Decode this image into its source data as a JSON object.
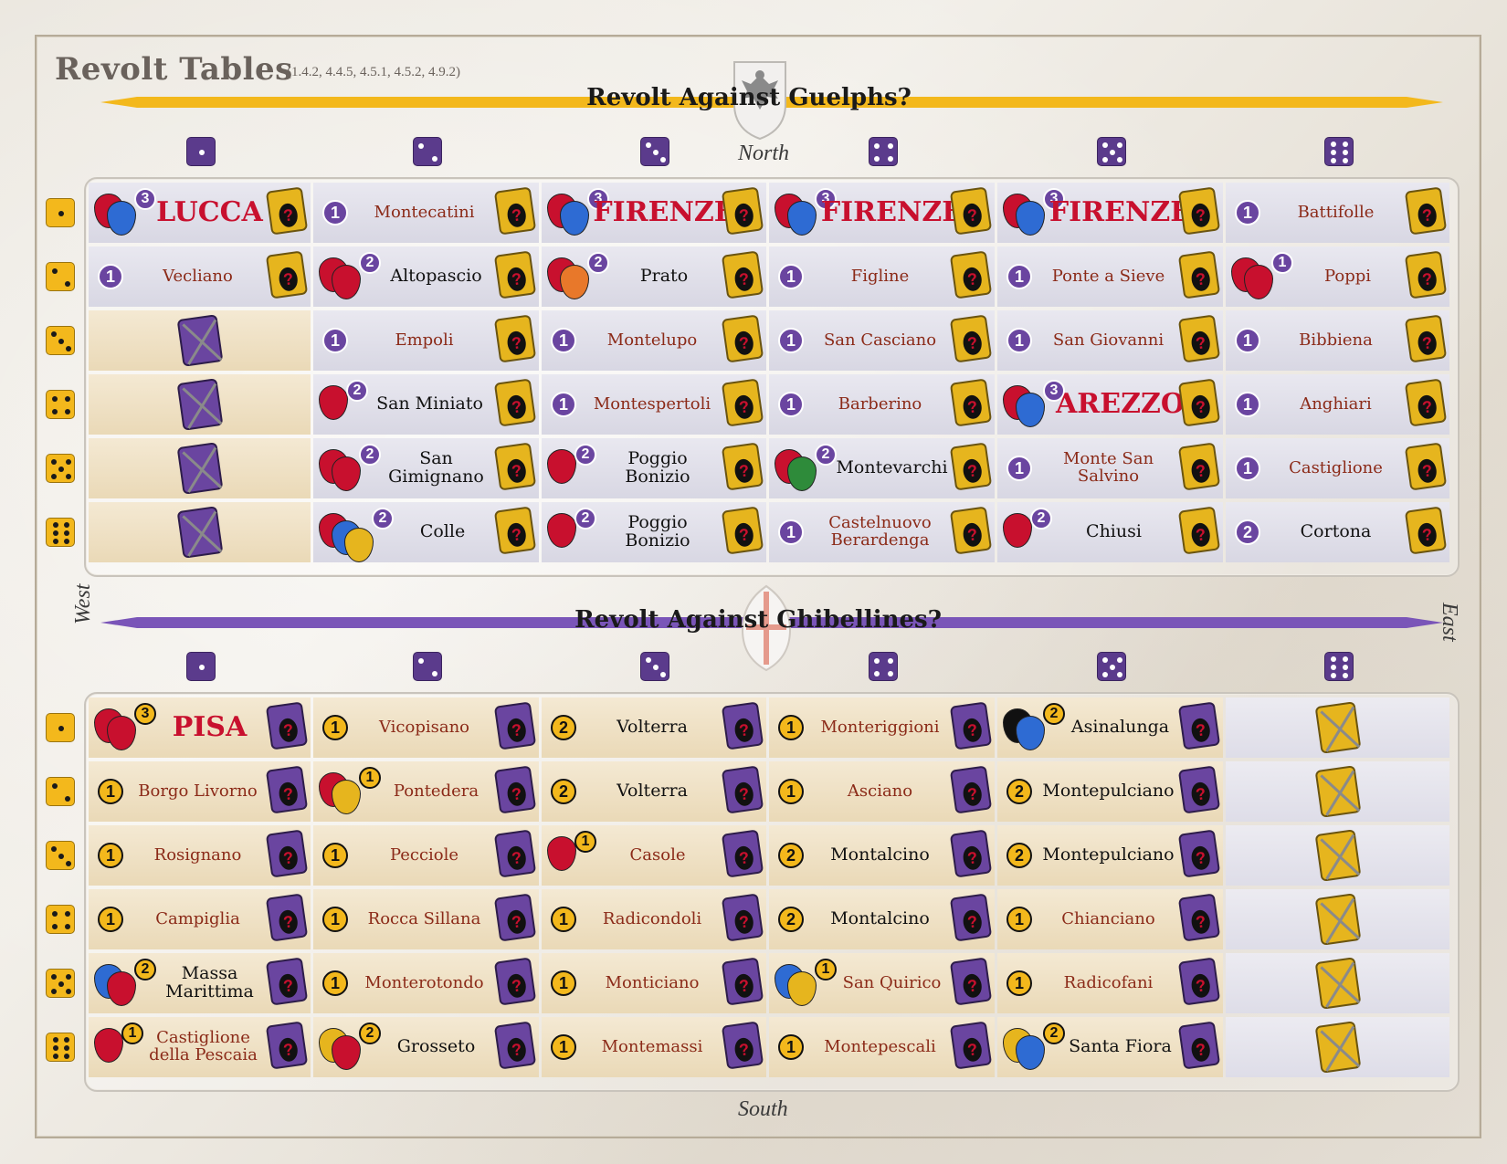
{
  "title": "Revolt Tables",
  "title_refs": "(1.4.2, 4.4.5, 4.5.1, 4.5.2, 4.9.2)",
  "compass": {
    "north": "North",
    "south": "South",
    "west": "West",
    "east": "East"
  },
  "colors": {
    "guelph_purple": "#6a45a0",
    "ghibelline_yellow": "#f3b81c",
    "city_red": "#c8102e",
    "town_brown": "#8b2a18"
  },
  "guelph_table": {
    "banner": "Revolt Against Guelphs?",
    "column_dice": [
      1,
      2,
      3,
      4,
      5,
      6
    ],
    "row_dice": [
      1,
      2,
      3,
      4,
      5,
      6
    ],
    "rows": [
      [
        {
          "name": "LUCCA",
          "style": "big",
          "value": "3",
          "shields": [
            "#c8102e",
            "#2e6bd3"
          ],
          "token": "ghibelline"
        },
        {
          "name": "Montecatini",
          "style": "red",
          "value": "1",
          "token": "ghibelline"
        },
        {
          "name": "FIRENZE",
          "style": "big",
          "value": "3",
          "shields": [
            "#c8102e",
            "#2e6bd3"
          ],
          "token": "ghibelline"
        },
        {
          "name": "FIRENZE",
          "style": "big",
          "value": "3",
          "shields": [
            "#c8102e",
            "#2e6bd3"
          ],
          "token": "ghibelline"
        },
        {
          "name": "FIRENZE",
          "style": "big",
          "value": "3",
          "shields": [
            "#c8102e",
            "#2e6bd3"
          ],
          "token": "ghibelline"
        },
        {
          "name": "Battifolle",
          "style": "red",
          "value": "1",
          "token": "ghibelline"
        }
      ],
      [
        {
          "name": "Vecliano",
          "style": "red",
          "value": "1",
          "token": "ghibelline"
        },
        {
          "name": "Altopascio",
          "style": "blk",
          "value": "2",
          "shields": [
            "#c8102e",
            "#c8102e"
          ],
          "token": "ghibelline"
        },
        {
          "name": "Prato",
          "style": "blk",
          "value": "2",
          "shields": [
            "#c8102e",
            "#e8782a"
          ],
          "token": "ghibelline"
        },
        {
          "name": "Figline",
          "style": "red",
          "value": "1",
          "token": "ghibelline"
        },
        {
          "name": "Ponte a Sieve",
          "style": "red",
          "value": "1",
          "token": "ghibelline"
        },
        {
          "name": "Poppi",
          "style": "red",
          "value": "1",
          "shields": [
            "#c8102e",
            "#c8102e"
          ],
          "token": "ghibelline"
        }
      ],
      [
        {
          "name": "",
          "style": "none",
          "value": "",
          "token": "guelph-x"
        },
        {
          "name": "Empoli",
          "style": "red",
          "value": "1",
          "token": "ghibelline"
        },
        {
          "name": "Montelupo",
          "style": "red",
          "value": "1",
          "token": "ghibelline"
        },
        {
          "name": "San Casciano",
          "style": "red",
          "value": "1",
          "token": "ghibelline"
        },
        {
          "name": "San Giovanni",
          "style": "red",
          "value": "1",
          "token": "ghibelline"
        },
        {
          "name": "Bibbiena",
          "style": "red",
          "value": "1",
          "token": "ghibelline"
        }
      ],
      [
        {
          "name": "",
          "style": "none",
          "value": "",
          "token": "guelph-x"
        },
        {
          "name": "San Miniato",
          "style": "blk",
          "value": "2",
          "shields": [
            "#c8102e"
          ],
          "token": "ghibelline"
        },
        {
          "name": "Montespertoli",
          "style": "red",
          "value": "1",
          "token": "ghibelline"
        },
        {
          "name": "Barberino",
          "style": "red",
          "value": "1",
          "token": "ghibelline"
        },
        {
          "name": "AREZZO",
          "style": "big",
          "value": "3",
          "shields": [
            "#c8102e",
            "#2e6bd3"
          ],
          "token": "ghibelline"
        },
        {
          "name": "Anghiari",
          "style": "red",
          "value": "1",
          "token": "ghibelline"
        }
      ],
      [
        {
          "name": "",
          "style": "none",
          "value": "",
          "token": "guelph-x"
        },
        {
          "name": "San Gimignano",
          "style": "blk",
          "value": "2",
          "shields": [
            "#c8102e",
            "#c8102e"
          ],
          "token": "ghibelline"
        },
        {
          "name": "Poggio Bonizio",
          "style": "blk",
          "value": "2",
          "shields": [
            "#c8102e"
          ],
          "token": "ghibelline"
        },
        {
          "name": "Montevarchi",
          "style": "blk",
          "value": "2",
          "shields": [
            "#c8102e",
            "#2e8b3a"
          ],
          "token": "ghibelline"
        },
        {
          "name": "Monte San Salvino",
          "style": "red",
          "value": "1",
          "token": "ghibelline"
        },
        {
          "name": "Castiglione",
          "style": "red",
          "value": "1",
          "token": "ghibelline"
        }
      ],
      [
        {
          "name": "",
          "style": "none",
          "value": "",
          "token": "guelph-x"
        },
        {
          "name": "Colle",
          "style": "blk",
          "value": "2",
          "shields": [
            "#c8102e",
            "#2e6bd3",
            "#e6b51e"
          ],
          "token": "ghibelline"
        },
        {
          "name": "Poggio Bonizio",
          "style": "blk",
          "value": "2",
          "shields": [
            "#c8102e"
          ],
          "token": "ghibelline"
        },
        {
          "name": "Castelnuovo Berardenga",
          "style": "red",
          "value": "1",
          "token": "ghibelline"
        },
        {
          "name": "Chiusi",
          "style": "blk",
          "value": "2",
          "shields": [
            "#c8102e"
          ],
          "token": "ghibelline"
        },
        {
          "name": "Cortona",
          "style": "blk",
          "value": "2",
          "token": "ghibelline"
        }
      ]
    ]
  },
  "ghibelline_table": {
    "banner": "Revolt Against Ghibellines?",
    "column_dice": [
      1,
      2,
      3,
      4,
      5,
      6
    ],
    "row_dice": [
      1,
      2,
      3,
      4,
      5,
      6
    ],
    "rows": [
      [
        {
          "name": "PISA",
          "style": "big",
          "value": "3",
          "shields": [
            "#c8102e",
            "#c8102e"
          ],
          "token": "guelph"
        },
        {
          "name": "Vicopisano",
          "style": "red",
          "value": "1",
          "token": "guelph"
        },
        {
          "name": "Volterra",
          "style": "blk",
          "value": "2",
          "token": "guelph"
        },
        {
          "name": "Monteriggioni",
          "style": "red",
          "value": "1",
          "token": "guelph"
        },
        {
          "name": "Asinalunga",
          "style": "blk",
          "value": "2",
          "shields": [
            "#111111",
            "#2e6bd3"
          ],
          "token": "guelph"
        },
        {
          "name": "",
          "style": "none",
          "value": "",
          "token": "ghibelline-x"
        }
      ],
      [
        {
          "name": "Borgo Livorno",
          "style": "red",
          "value": "1",
          "token": "guelph"
        },
        {
          "name": "Pontedera",
          "style": "red",
          "value": "1",
          "shields": [
            "#c8102e",
            "#e6b51e"
          ],
          "token": "guelph"
        },
        {
          "name": "Volterra",
          "style": "blk",
          "value": "2",
          "token": "guelph"
        },
        {
          "name": "Asciano",
          "style": "red",
          "value": "1",
          "token": "guelph"
        },
        {
          "name": "Montepulciano",
          "style": "blk",
          "value": "2",
          "token": "guelph"
        },
        {
          "name": "",
          "style": "none",
          "value": "",
          "token": "ghibelline-x"
        }
      ],
      [
        {
          "name": "Rosignano",
          "style": "red",
          "value": "1",
          "token": "guelph"
        },
        {
          "name": "Pecciole",
          "style": "red",
          "value": "1",
          "token": "guelph"
        },
        {
          "name": "Casole",
          "style": "red",
          "value": "1",
          "shields": [
            "#c8102e"
          ],
          "token": "guelph"
        },
        {
          "name": "Montalcino",
          "style": "blk",
          "value": "2",
          "token": "guelph"
        },
        {
          "name": "Montepulciano",
          "style": "blk",
          "value": "2",
          "token": "guelph"
        },
        {
          "name": "",
          "style": "none",
          "value": "",
          "token": "ghibelline-x"
        }
      ],
      [
        {
          "name": "Campiglia",
          "style": "red",
          "value": "1",
          "token": "guelph"
        },
        {
          "name": "Rocca Sillana",
          "style": "red",
          "value": "1",
          "token": "guelph"
        },
        {
          "name": "Radicondoli",
          "style": "red",
          "value": "1",
          "token": "guelph"
        },
        {
          "name": "Montalcino",
          "style": "blk",
          "value": "2",
          "token": "guelph"
        },
        {
          "name": "Chianciano",
          "style": "red",
          "value": "1",
          "token": "guelph"
        },
        {
          "name": "",
          "style": "none",
          "value": "",
          "token": "ghibelline-x"
        }
      ],
      [
        {
          "name": "Massa Marittima",
          "style": "blk",
          "value": "2",
          "shields": [
            "#2e6bd3",
            "#c8102e"
          ],
          "token": "guelph"
        },
        {
          "name": "Monterotondo",
          "style": "red",
          "value": "1",
          "token": "guelph"
        },
        {
          "name": "Monticiano",
          "style": "red",
          "value": "1",
          "token": "guelph"
        },
        {
          "name": "San Quirico",
          "style": "red",
          "value": "1",
          "shields": [
            "#2e6bd3",
            "#e6b51e"
          ],
          "token": "guelph"
        },
        {
          "name": "Radicofani",
          "style": "red",
          "value": "1",
          "token": "guelph"
        },
        {
          "name": "",
          "style": "none",
          "value": "",
          "token": "ghibelline-x"
        }
      ],
      [
        {
          "name": "Castiglione della Pescaia",
          "style": "red",
          "value": "1",
          "shields": [
            "#c8102e"
          ],
          "token": "guelph"
        },
        {
          "name": "Grosseto",
          "style": "blk",
          "value": "2",
          "shields": [
            "#e6b51e",
            "#c8102e"
          ],
          "token": "guelph"
        },
        {
          "name": "Montemassi",
          "style": "red",
          "value": "1",
          "token": "guelph"
        },
        {
          "name": "Montepescali",
          "style": "red",
          "value": "1",
          "token": "guelph"
        },
        {
          "name": "Santa Fiora",
          "style": "blk",
          "value": "2",
          "shields": [
            "#e6b51e",
            "#2e6bd3"
          ],
          "token": "guelph"
        },
        {
          "name": "",
          "style": "none",
          "value": "",
          "token": "ghibelline-x"
        }
      ]
    ]
  }
}
